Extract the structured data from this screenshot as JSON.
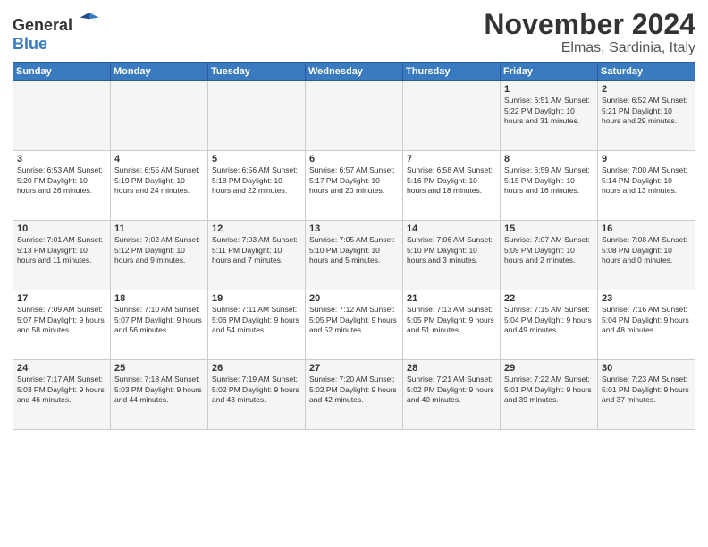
{
  "logo": {
    "general": "General",
    "blue": "Blue"
  },
  "header": {
    "month": "November 2024",
    "location": "Elmas, Sardinia, Italy"
  },
  "weekdays": [
    "Sunday",
    "Monday",
    "Tuesday",
    "Wednesday",
    "Thursday",
    "Friday",
    "Saturday"
  ],
  "weeks": [
    [
      {
        "day": "",
        "info": ""
      },
      {
        "day": "",
        "info": ""
      },
      {
        "day": "",
        "info": ""
      },
      {
        "day": "",
        "info": ""
      },
      {
        "day": "",
        "info": ""
      },
      {
        "day": "1",
        "info": "Sunrise: 6:51 AM\nSunset: 5:22 PM\nDaylight: 10 hours\nand 31 minutes."
      },
      {
        "day": "2",
        "info": "Sunrise: 6:52 AM\nSunset: 5:21 PM\nDaylight: 10 hours\nand 29 minutes."
      }
    ],
    [
      {
        "day": "3",
        "info": "Sunrise: 6:53 AM\nSunset: 5:20 PM\nDaylight: 10 hours\nand 26 minutes."
      },
      {
        "day": "4",
        "info": "Sunrise: 6:55 AM\nSunset: 5:19 PM\nDaylight: 10 hours\nand 24 minutes."
      },
      {
        "day": "5",
        "info": "Sunrise: 6:56 AM\nSunset: 5:18 PM\nDaylight: 10 hours\nand 22 minutes."
      },
      {
        "day": "6",
        "info": "Sunrise: 6:57 AM\nSunset: 5:17 PM\nDaylight: 10 hours\nand 20 minutes."
      },
      {
        "day": "7",
        "info": "Sunrise: 6:58 AM\nSunset: 5:16 PM\nDaylight: 10 hours\nand 18 minutes."
      },
      {
        "day": "8",
        "info": "Sunrise: 6:59 AM\nSunset: 5:15 PM\nDaylight: 10 hours\nand 16 minutes."
      },
      {
        "day": "9",
        "info": "Sunrise: 7:00 AM\nSunset: 5:14 PM\nDaylight: 10 hours\nand 13 minutes."
      }
    ],
    [
      {
        "day": "10",
        "info": "Sunrise: 7:01 AM\nSunset: 5:13 PM\nDaylight: 10 hours\nand 11 minutes."
      },
      {
        "day": "11",
        "info": "Sunrise: 7:02 AM\nSunset: 5:12 PM\nDaylight: 10 hours\nand 9 minutes."
      },
      {
        "day": "12",
        "info": "Sunrise: 7:03 AM\nSunset: 5:11 PM\nDaylight: 10 hours\nand 7 minutes."
      },
      {
        "day": "13",
        "info": "Sunrise: 7:05 AM\nSunset: 5:10 PM\nDaylight: 10 hours\nand 5 minutes."
      },
      {
        "day": "14",
        "info": "Sunrise: 7:06 AM\nSunset: 5:10 PM\nDaylight: 10 hours\nand 3 minutes."
      },
      {
        "day": "15",
        "info": "Sunrise: 7:07 AM\nSunset: 5:09 PM\nDaylight: 10 hours\nand 2 minutes."
      },
      {
        "day": "16",
        "info": "Sunrise: 7:08 AM\nSunset: 5:08 PM\nDaylight: 10 hours\nand 0 minutes."
      }
    ],
    [
      {
        "day": "17",
        "info": "Sunrise: 7:09 AM\nSunset: 5:07 PM\nDaylight: 9 hours\nand 58 minutes."
      },
      {
        "day": "18",
        "info": "Sunrise: 7:10 AM\nSunset: 5:07 PM\nDaylight: 9 hours\nand 56 minutes."
      },
      {
        "day": "19",
        "info": "Sunrise: 7:11 AM\nSunset: 5:06 PM\nDaylight: 9 hours\nand 54 minutes."
      },
      {
        "day": "20",
        "info": "Sunrise: 7:12 AM\nSunset: 5:05 PM\nDaylight: 9 hours\nand 52 minutes."
      },
      {
        "day": "21",
        "info": "Sunrise: 7:13 AM\nSunset: 5:05 PM\nDaylight: 9 hours\nand 51 minutes."
      },
      {
        "day": "22",
        "info": "Sunrise: 7:15 AM\nSunset: 5:04 PM\nDaylight: 9 hours\nand 49 minutes."
      },
      {
        "day": "23",
        "info": "Sunrise: 7:16 AM\nSunset: 5:04 PM\nDaylight: 9 hours\nand 48 minutes."
      }
    ],
    [
      {
        "day": "24",
        "info": "Sunrise: 7:17 AM\nSunset: 5:03 PM\nDaylight: 9 hours\nand 46 minutes."
      },
      {
        "day": "25",
        "info": "Sunrise: 7:18 AM\nSunset: 5:03 PM\nDaylight: 9 hours\nand 44 minutes."
      },
      {
        "day": "26",
        "info": "Sunrise: 7:19 AM\nSunset: 5:02 PM\nDaylight: 9 hours\nand 43 minutes."
      },
      {
        "day": "27",
        "info": "Sunrise: 7:20 AM\nSunset: 5:02 PM\nDaylight: 9 hours\nand 42 minutes."
      },
      {
        "day": "28",
        "info": "Sunrise: 7:21 AM\nSunset: 5:02 PM\nDaylight: 9 hours\nand 40 minutes."
      },
      {
        "day": "29",
        "info": "Sunrise: 7:22 AM\nSunset: 5:01 PM\nDaylight: 9 hours\nand 39 minutes."
      },
      {
        "day": "30",
        "info": "Sunrise: 7:23 AM\nSunset: 5:01 PM\nDaylight: 9 hours\nand 37 minutes."
      }
    ]
  ]
}
